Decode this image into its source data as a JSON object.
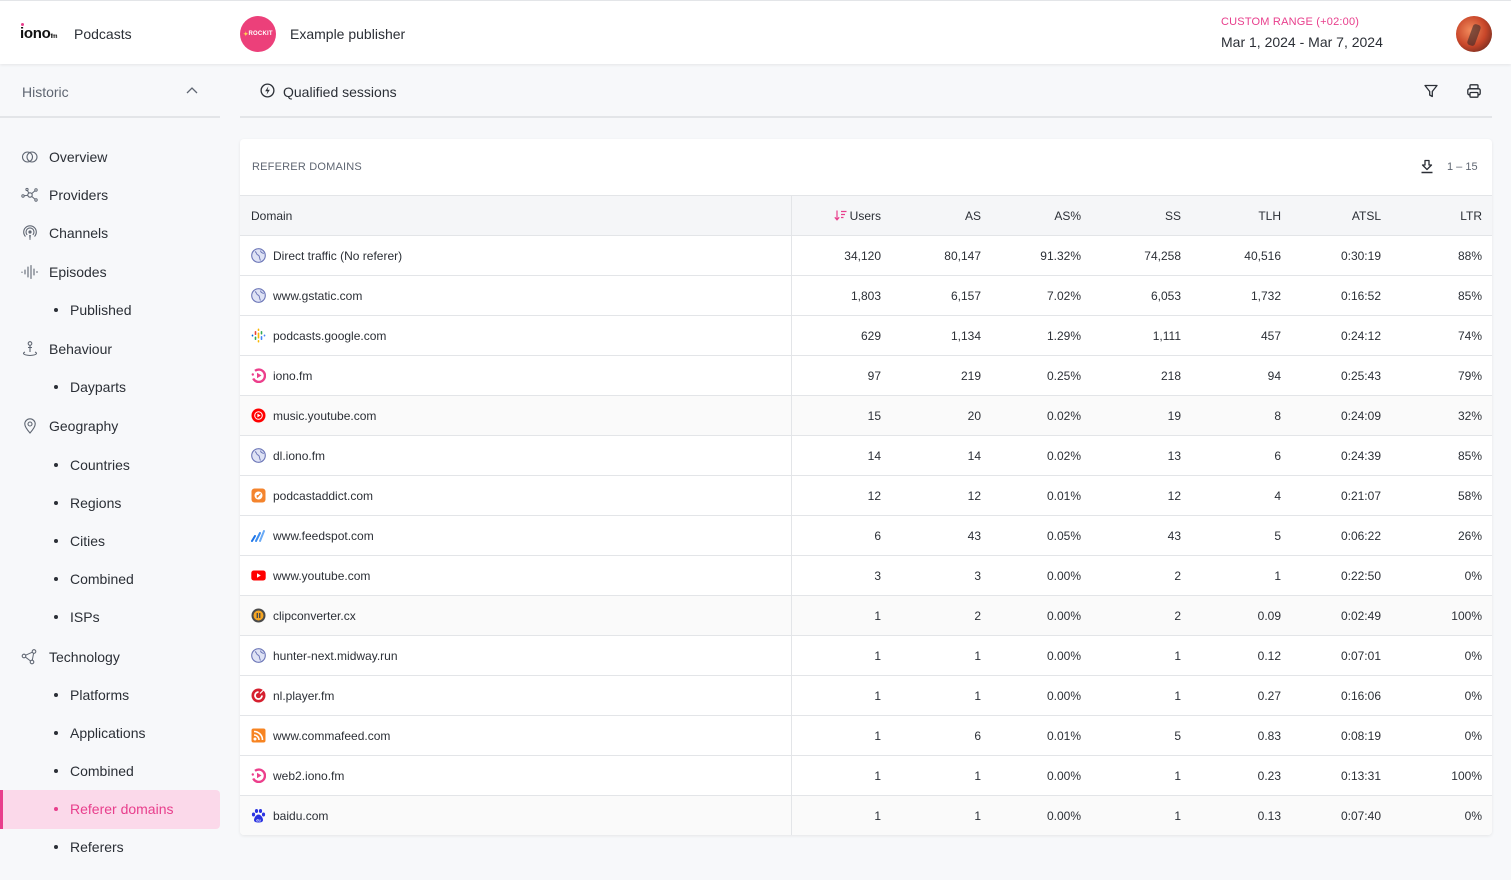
{
  "header": {
    "logo_text": "iono",
    "logo_suffix": "fm",
    "app_name": "Podcasts",
    "publisher_avatar_text": "ROCKIT",
    "publisher_name": "Example publisher",
    "range_label": "CUSTOM RANGE (+02:00)",
    "range_value": "Mar 1, 2024 - Mar 7, 2024"
  },
  "sidebar": {
    "section_label": "Historic",
    "items": [
      {
        "label": "Overview",
        "icon": "overview-icon",
        "sub": false
      },
      {
        "label": "Providers",
        "icon": "providers-icon",
        "sub": false
      },
      {
        "label": "Channels",
        "icon": "channels-icon",
        "sub": false
      },
      {
        "label": "Episodes",
        "icon": "episodes-icon",
        "sub": false
      },
      {
        "label": "Published",
        "sub": true
      },
      {
        "label": "Behaviour",
        "icon": "behaviour-icon",
        "sub": false
      },
      {
        "label": "Dayparts",
        "sub": true
      },
      {
        "label": "Geography",
        "icon": "location-pin-icon",
        "sub": false
      },
      {
        "label": "Countries",
        "sub": true
      },
      {
        "label": "Regions",
        "sub": true
      },
      {
        "label": "Cities",
        "sub": true
      },
      {
        "label": "Combined",
        "sub": true
      },
      {
        "label": "ISPs",
        "sub": true
      },
      {
        "label": "Technology",
        "icon": "technology-icon",
        "sub": false
      },
      {
        "label": "Platforms",
        "sub": true
      },
      {
        "label": "Applications",
        "sub": true
      },
      {
        "label": "Combined",
        "sub": true
      },
      {
        "label": "Referer domains",
        "sub": true,
        "active": true
      },
      {
        "label": "Referers",
        "sub": true
      }
    ]
  },
  "toolbar": {
    "metric_label": "Qualified sessions"
  },
  "card": {
    "title": "REFERER DOMAINS",
    "pagination": "1 – 15",
    "columns": [
      "Domain",
      "Users",
      "AS",
      "AS%",
      "SS",
      "TLH",
      "ATSL",
      "LTR"
    ],
    "sort_column": "Users",
    "sort_direction": "desc",
    "rows": [
      {
        "domain": "Direct traffic (No referer)",
        "icon": "globe",
        "users": "34,120",
        "as": "80,147",
        "as_pct": "91.32%",
        "ss": "74,258",
        "tlh": "40,516",
        "atsl": "0:30:19",
        "ltr": "88%"
      },
      {
        "domain": "www.gstatic.com",
        "icon": "globe",
        "users": "1,803",
        "as": "6,157",
        "as_pct": "7.02%",
        "ss": "6,053",
        "tlh": "1,732",
        "atsl": "0:16:52",
        "ltr": "85%"
      },
      {
        "domain": "podcasts.google.com",
        "icon": "google-podcasts",
        "users": "629",
        "as": "1,134",
        "as_pct": "1.29%",
        "ss": "1,111",
        "tlh": "457",
        "atsl": "0:24:12",
        "ltr": "74%"
      },
      {
        "domain": "iono.fm",
        "icon": "iono",
        "users": "97",
        "as": "219",
        "as_pct": "0.25%",
        "ss": "218",
        "tlh": "94",
        "atsl": "0:25:43",
        "ltr": "79%"
      },
      {
        "domain": "music.youtube.com",
        "icon": "youtube-music",
        "users": "15",
        "as": "20",
        "as_pct": "0.02%",
        "ss": "19",
        "tlh": "8",
        "atsl": "0:24:09",
        "ltr": "32%"
      },
      {
        "domain": "dl.iono.fm",
        "icon": "globe",
        "users": "14",
        "as": "14",
        "as_pct": "0.02%",
        "ss": "13",
        "tlh": "6",
        "atsl": "0:24:39",
        "ltr": "85%"
      },
      {
        "domain": "podcastaddict.com",
        "icon": "podcastaddict",
        "users": "12",
        "as": "12",
        "as_pct": "0.01%",
        "ss": "12",
        "tlh": "4",
        "atsl": "0:21:07",
        "ltr": "58%"
      },
      {
        "domain": "www.feedspot.com",
        "icon": "feedspot",
        "users": "6",
        "as": "43",
        "as_pct": "0.05%",
        "ss": "43",
        "tlh": "5",
        "atsl": "0:06:22",
        "ltr": "26%"
      },
      {
        "domain": "www.youtube.com",
        "icon": "youtube",
        "users": "3",
        "as": "3",
        "as_pct": "0.00%",
        "ss": "2",
        "tlh": "1",
        "atsl": "0:22:50",
        "ltr": "0%"
      },
      {
        "domain": "clipconverter.cx",
        "icon": "clipconverter",
        "users": "1",
        "as": "2",
        "as_pct": "0.00%",
        "ss": "2",
        "tlh": "0.09",
        "atsl": "0:02:49",
        "ltr": "100%"
      },
      {
        "domain": "hunter-next.midway.run",
        "icon": "globe",
        "users": "1",
        "as": "1",
        "as_pct": "0.00%",
        "ss": "1",
        "tlh": "0.12",
        "atsl": "0:07:01",
        "ltr": "0%"
      },
      {
        "domain": "nl.player.fm",
        "icon": "playerfm",
        "users": "1",
        "as": "1",
        "as_pct": "0.00%",
        "ss": "1",
        "tlh": "0.27",
        "atsl": "0:16:06",
        "ltr": "0%"
      },
      {
        "domain": "www.commafeed.com",
        "icon": "rss",
        "users": "1",
        "as": "6",
        "as_pct": "0.01%",
        "ss": "5",
        "tlh": "0.83",
        "atsl": "0:08:19",
        "ltr": "0%"
      },
      {
        "domain": "web2.iono.fm",
        "icon": "iono",
        "users": "1",
        "as": "1",
        "as_pct": "0.00%",
        "ss": "1",
        "tlh": "0.23",
        "atsl": "0:13:31",
        "ltr": "100%"
      },
      {
        "domain": "baidu.com",
        "icon": "baidu",
        "users": "1",
        "as": "1",
        "as_pct": "0.00%",
        "ss": "1",
        "tlh": "0.13",
        "atsl": "0:07:40",
        "ltr": "0%"
      }
    ]
  },
  "colors": {
    "accent": "#e83e8c",
    "active_bg": "#fbd9ea",
    "text": "#2b2f36",
    "muted": "#5f6672"
  }
}
